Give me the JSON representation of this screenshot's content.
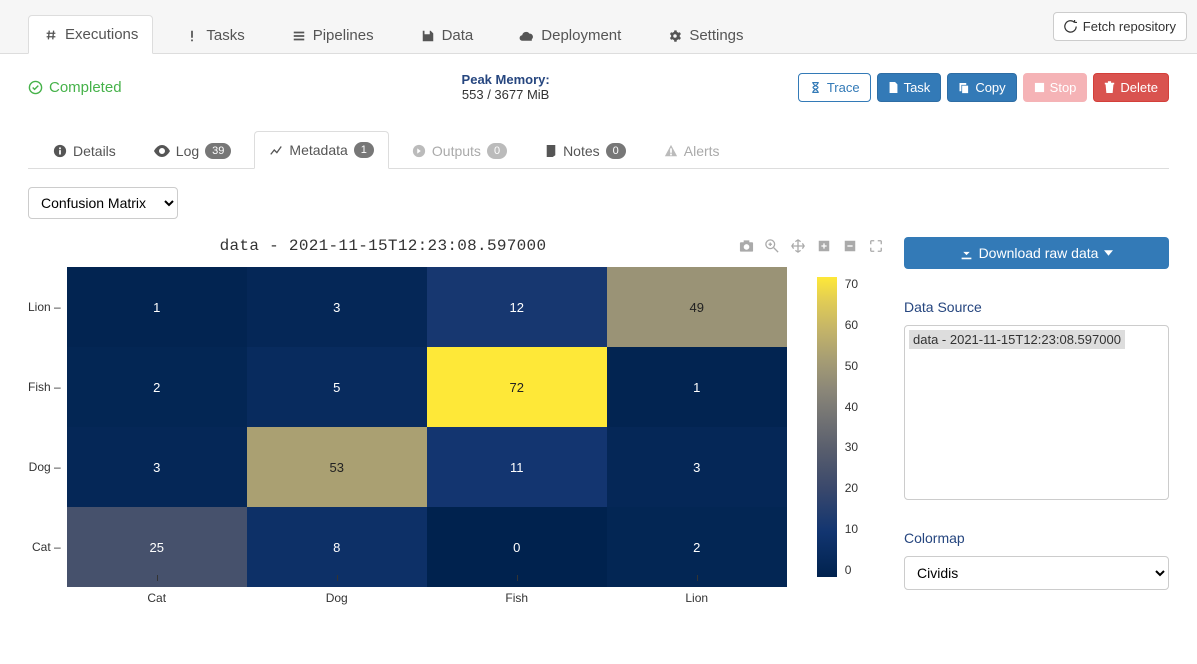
{
  "nav": {
    "executions": "Executions",
    "tasks": "Tasks",
    "pipelines": "Pipelines",
    "data": "Data",
    "deployment": "Deployment",
    "settings": "Settings",
    "fetch": "Fetch repository"
  },
  "status": {
    "label": "Completed"
  },
  "peak": {
    "title": "Peak Memory:",
    "value": "553 / 3677 MiB"
  },
  "actions": {
    "trace": "Trace",
    "task": "Task",
    "copy": "Copy",
    "stop": "Stop",
    "delete": "Delete"
  },
  "subtabs": {
    "details": "Details",
    "log": "Log",
    "log_badge": "39",
    "metadata": "Metadata",
    "metadata_badge": "1",
    "outputs": "Outputs",
    "outputs_badge": "0",
    "notes": "Notes",
    "notes_badge": "0",
    "alerts": "Alerts"
  },
  "metadata_type": "Confusion Matrix",
  "chart_title": "data - 2021-11-15T12:23:08.597000",
  "side": {
    "download": "Download raw data",
    "ds_label": "Data Source",
    "ds_item": "data - 2021-11-15T12:23:08.597000",
    "colormap_label": "Colormap",
    "colormap_value": "Cividis"
  },
  "chart_data": {
    "type": "heatmap",
    "title": "data - 2021-11-15T12:23:08.597000",
    "x_categories": [
      "Cat",
      "Dog",
      "Fish",
      "Lion"
    ],
    "y_categories": [
      "Lion",
      "Fish",
      "Dog",
      "Cat"
    ],
    "values": [
      [
        1,
        3,
        12,
        49
      ],
      [
        2,
        5,
        72,
        1
      ],
      [
        3,
        53,
        11,
        3
      ],
      [
        25,
        8,
        0,
        2
      ]
    ],
    "colorbar": {
      "min": 0,
      "max": 70,
      "ticks": [
        70,
        60,
        50,
        40,
        30,
        20,
        10,
        0
      ]
    },
    "colormap": "Cividis"
  }
}
